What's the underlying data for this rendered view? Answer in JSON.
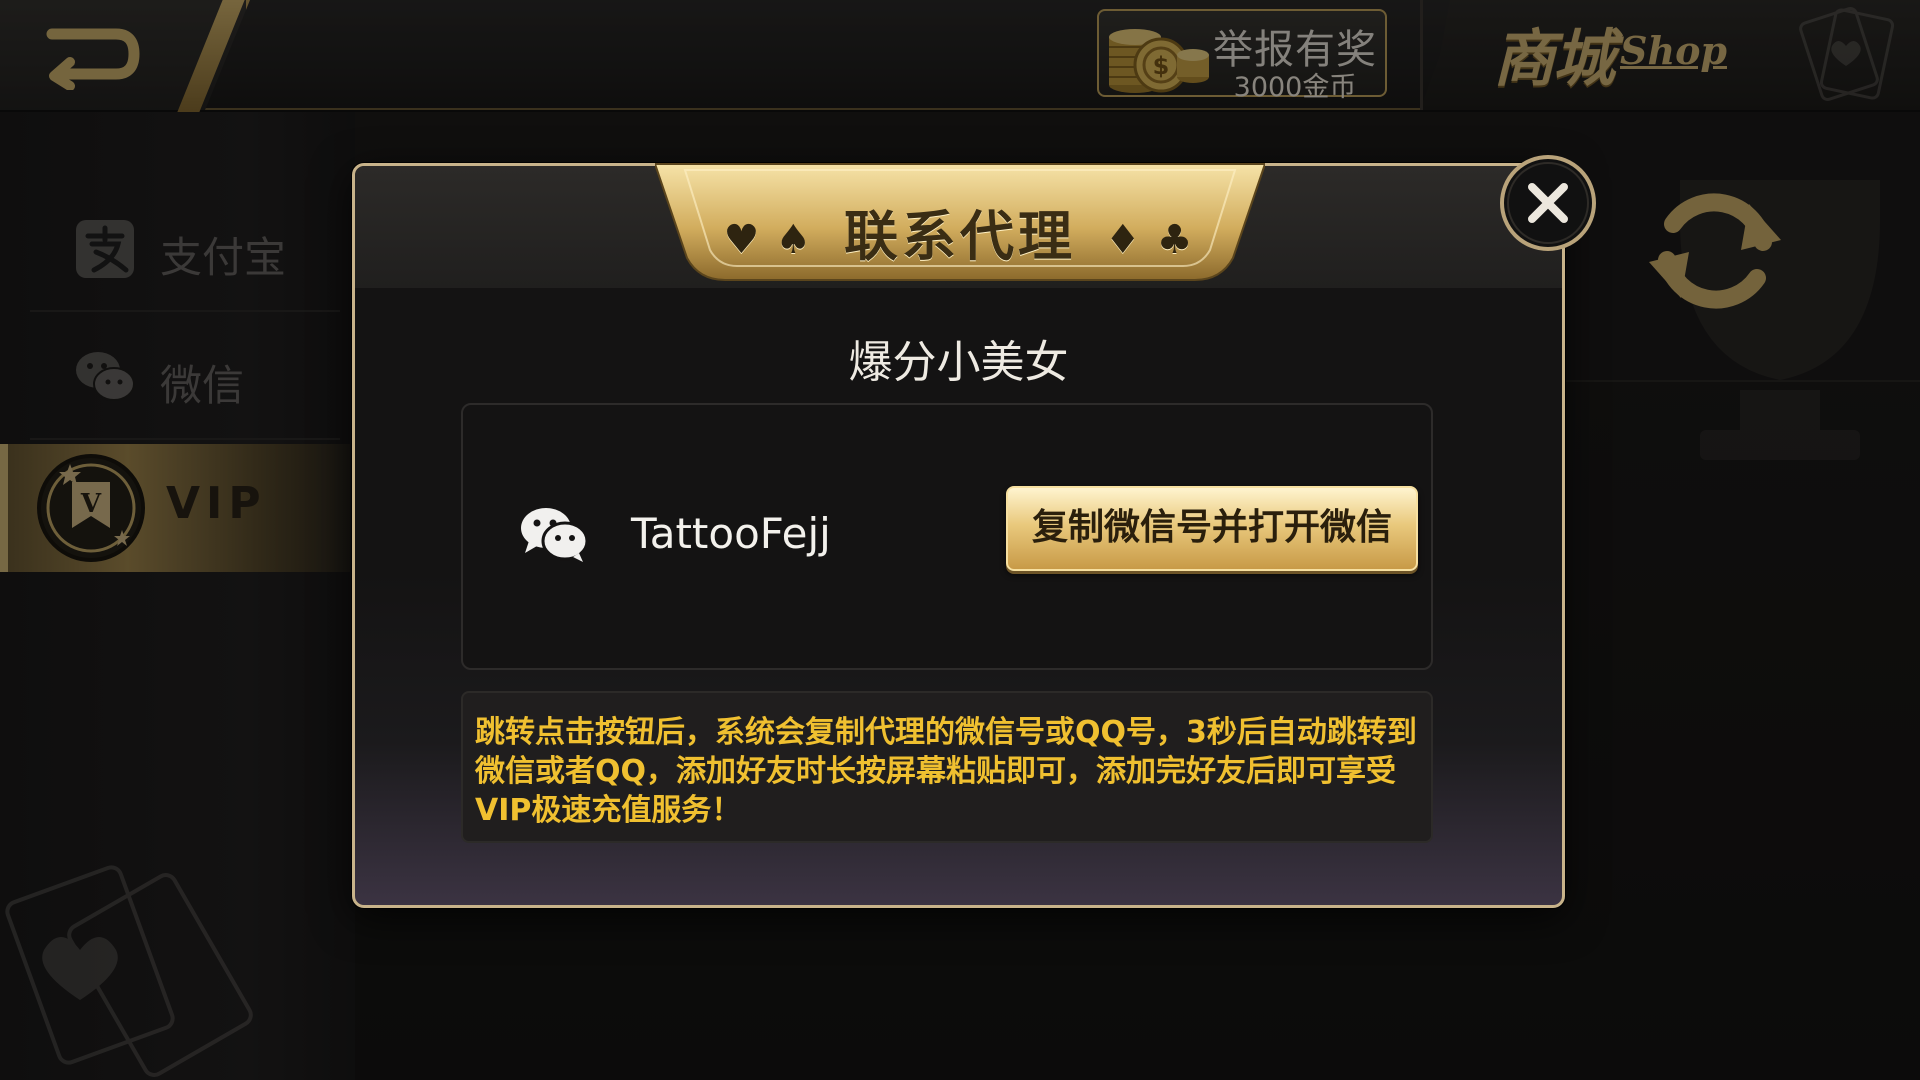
{
  "top_bar": {
    "report": {
      "title": "举报有奖",
      "reward": "3000金币"
    },
    "shop": {
      "label_cn": "商城",
      "label_en": "Shop"
    }
  },
  "sidebar": {
    "items": [
      {
        "label": "支付宝",
        "icon": "alipay-icon"
      },
      {
        "label": "微信",
        "icon": "wechat-icon"
      },
      {
        "label": "VIP",
        "icon": "vip-badge-icon",
        "active": true
      }
    ]
  },
  "modal": {
    "title": "联系代理",
    "agent_name": "爆分小美女",
    "wechat_id": "TattooFejj",
    "copy_button": "复制微信号并打开微信",
    "notice": "跳转点击按钮后，系统会复制代理的微信号或QQ号，3秒后自动跳转到微信或者QQ，添加好友时长按屏幕粘贴即可，添加完好友后即可享受VIP极速充值服务！"
  },
  "colors": {
    "accent_gold": "#c8a75e",
    "notice_text": "#f0c030",
    "background": "#121112"
  }
}
